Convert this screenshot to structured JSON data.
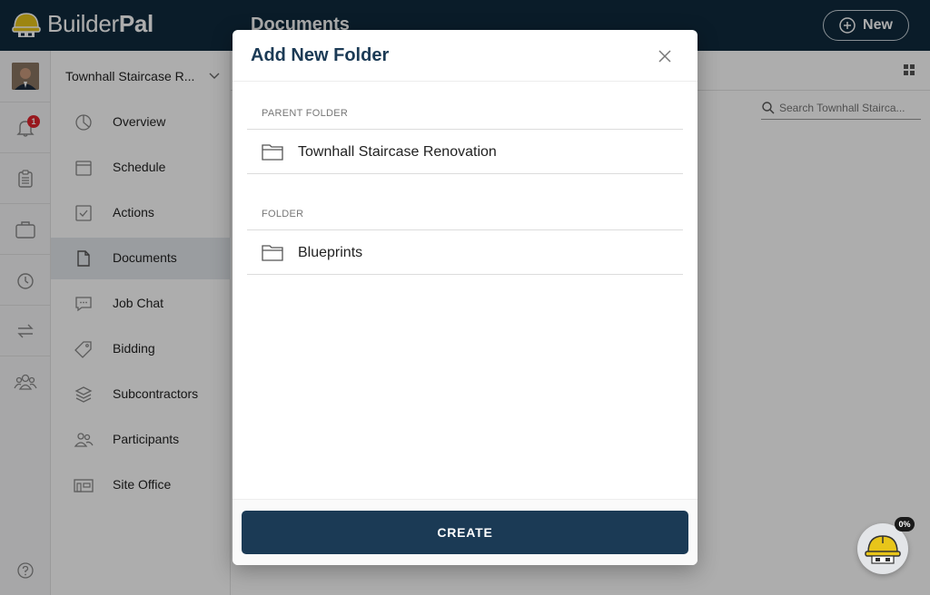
{
  "app": {
    "brand_regular": "Builder",
    "brand_bold": "Pal",
    "page_title": "Documents",
    "new_label": "New"
  },
  "rail": {
    "notification_count": "1",
    "icons": [
      "bell-icon",
      "clipboard-icon",
      "briefcase-icon",
      "timer-icon",
      "transfer-icon",
      "team-icon"
    ],
    "help_icon": "help-icon"
  },
  "sidebar": {
    "project_name": "Townhall Staircase R...",
    "items": [
      {
        "label": "Overview",
        "icon": "pie-chart-icon"
      },
      {
        "label": "Schedule",
        "icon": "calendar-icon"
      },
      {
        "label": "Actions",
        "icon": "checkbox-icon"
      },
      {
        "label": "Documents",
        "icon": "document-icon",
        "active": true
      },
      {
        "label": "Job Chat",
        "icon": "chat-icon"
      },
      {
        "label": "Bidding",
        "icon": "tag-icon"
      },
      {
        "label": "Subcontractors",
        "icon": "layers-icon"
      },
      {
        "label": "Participants",
        "icon": "people-icon"
      },
      {
        "label": "Site Office",
        "icon": "site-office-icon"
      }
    ]
  },
  "main": {
    "search_placeholder": "Search Townhall Stairca..."
  },
  "modal": {
    "title": "Add New Folder",
    "parent_folder_label": "PARENT FOLDER",
    "parent_folder_value": "Townhall Staircase Renovation",
    "folder_label": "FOLDER",
    "folder_value": "Blueprints",
    "create_label": "CREATE"
  },
  "assistant": {
    "progress_label": "0%"
  },
  "colors": {
    "topbar": "#0f2a3d",
    "primary": "#1b3a55",
    "badge": "#e0242d",
    "helmet": "#e8c51a"
  }
}
